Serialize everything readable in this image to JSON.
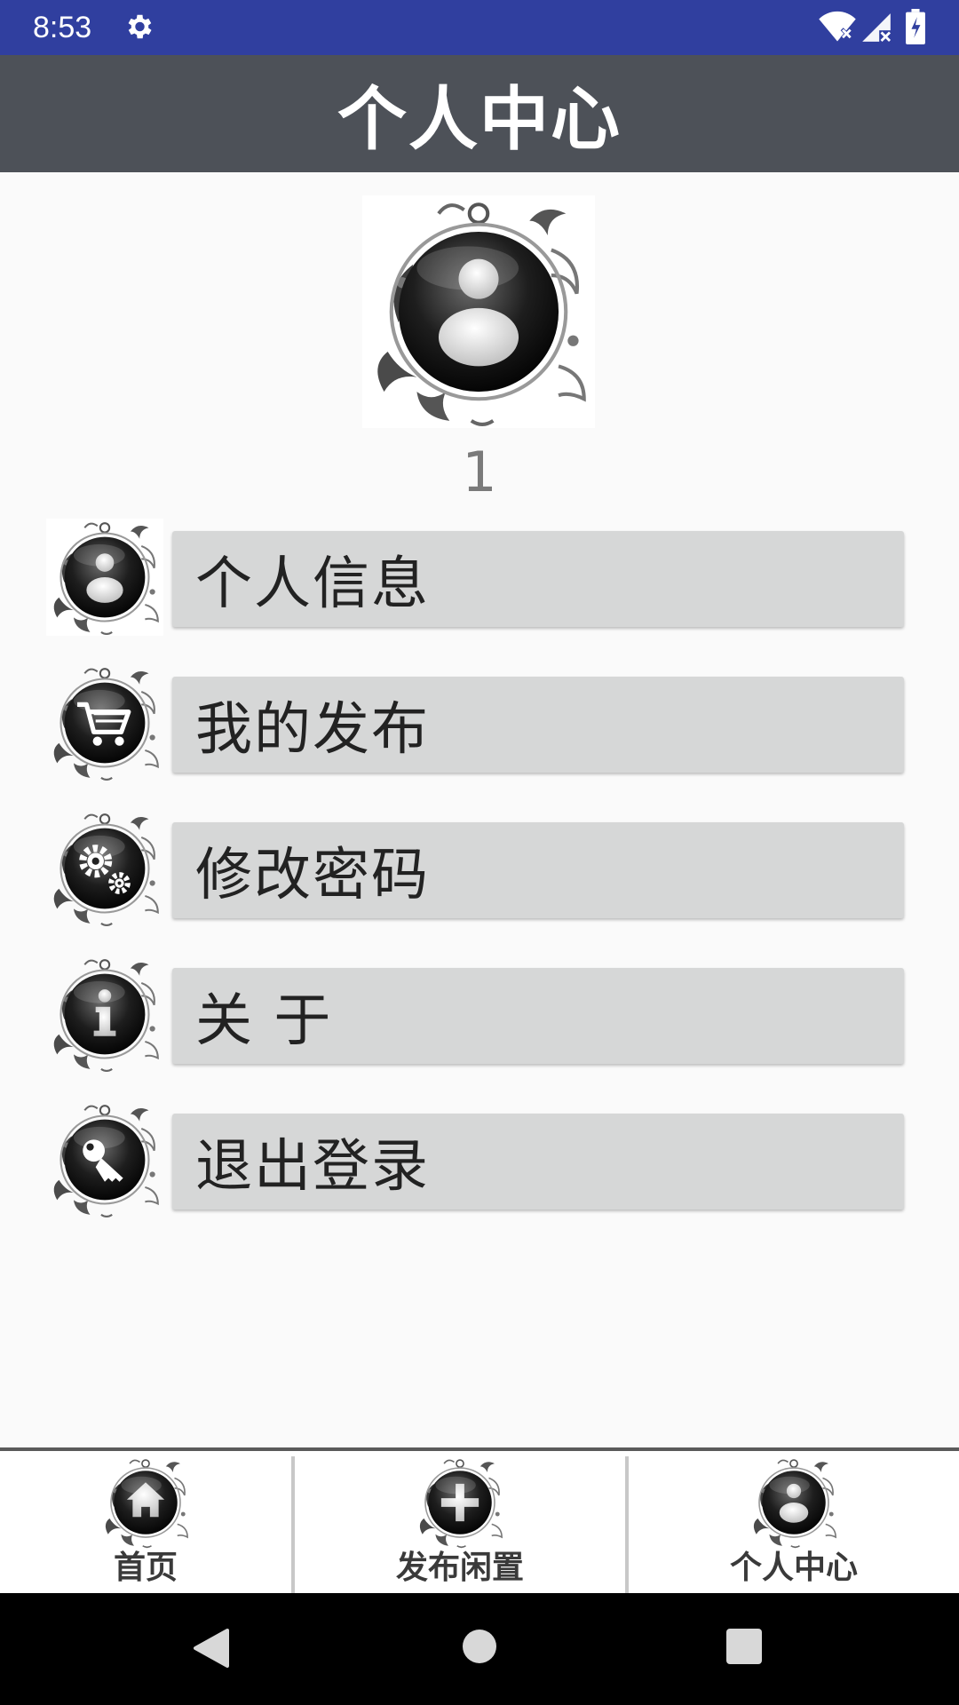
{
  "status_bar": {
    "time": "8:53",
    "icons": [
      "gear-icon",
      "wifi-icon",
      "signal-icon",
      "battery-icon"
    ],
    "background_color": "#303f9f"
  },
  "title_bar": {
    "title": "个人中心",
    "background_color": "#4d5158"
  },
  "profile": {
    "avatar_icon": "user-avatar-icon",
    "username": "1"
  },
  "menu": {
    "items": [
      {
        "icon": "user-icon",
        "label": "个人信息"
      },
      {
        "icon": "cart-icon",
        "label": "我的发布"
      },
      {
        "icon": "gears-icon",
        "label": "修改密码"
      },
      {
        "icon": "info-icon",
        "label": "关 于"
      },
      {
        "icon": "key-icon",
        "label": "退出登录"
      }
    ],
    "button_color": "#d6d7d7"
  },
  "bottom_nav": {
    "items": [
      {
        "icon": "home-icon",
        "label": "首页"
      },
      {
        "icon": "plus-icon",
        "label": "发布闲置"
      },
      {
        "icon": "user-icon",
        "label": "个人中心"
      }
    ]
  },
  "system_nav": {
    "buttons": [
      "back-triangle-icon",
      "home-circle-icon",
      "recents-square-icon"
    ]
  }
}
